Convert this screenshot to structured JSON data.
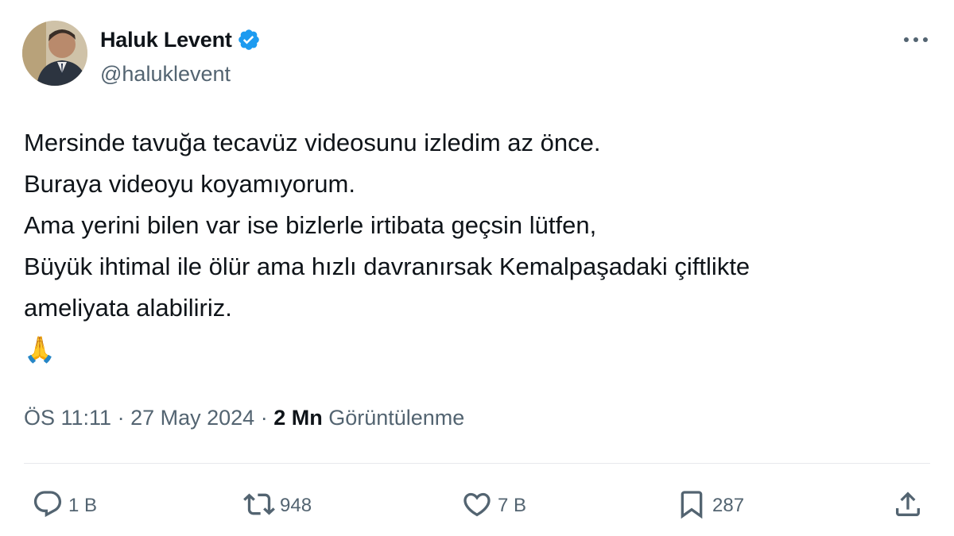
{
  "author": {
    "display_name": "Haluk Levent",
    "handle": "@haluklevent",
    "verified_icon": "verified-badge-icon",
    "verified_color": "#1d9bf0"
  },
  "tweet": {
    "lines": [
      "Mersinde tavuğa tecavüz videosunu izledim az önce.",
      "Buraya videoyu koyamıyorum.",
      "Ama yerini bilen var ise bizlerle irtibata geçsin lütfen,",
      "Büyük ihtimal ile ölür ama hızlı davranırsak Kemalpaşadaki çiftlikte",
      "ameliyata alabiliriz."
    ],
    "emoji": "🙏"
  },
  "meta": {
    "time": "ÖS 11:11",
    "separator": " · ",
    "date": "27 May 2024",
    "views_count": "2 Mn",
    "views_label": "Görüntülenme"
  },
  "actions": {
    "reply": {
      "icon": "reply-icon",
      "count": "1 B"
    },
    "retweet": {
      "icon": "retweet-icon",
      "count": "948"
    },
    "like": {
      "icon": "heart-icon",
      "count": "7 B"
    },
    "bookmark": {
      "icon": "bookmark-icon",
      "count": "287"
    },
    "share": {
      "icon": "share-icon"
    }
  },
  "colors": {
    "text_primary": "#0f1419",
    "text_secondary": "#536471",
    "divider": "#e7e9ec"
  }
}
